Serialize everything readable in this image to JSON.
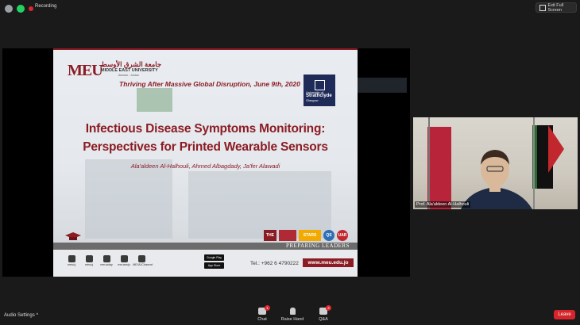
{
  "topbar": {
    "recording_label": "Recording",
    "exit_fullscreen_label": "Exit Full Screen",
    "colors": {
      "info_icon": "#9aa0a6",
      "shield_icon": "#23d160",
      "record_dot": "#e0262f"
    }
  },
  "slide": {
    "meu_logo": "MEU",
    "meu_arabic": "جامعة الشرق الأوسط",
    "meu_name": "MIDDLE EAST UNIVERSITY",
    "meu_location": "Amman - Jordan",
    "conference_title": "Thriving After Massive Global Disruption, June 9th, 2020",
    "partner_small": "University of",
    "partner_name": "Strathclyde",
    "partner_city": "Glasgow",
    "title_line1": "Infectious Disease Symptoms Monitoring:",
    "title_line2": "Perspectives for Printed Wearable Sensors",
    "authors": "Ala'aldeen Al-Halhouli, Ahmed Albagdady, Ja'fer Alawadi",
    "rankings": [
      "THE",
      "STARS",
      "QS",
      "UAR"
    ],
    "preparing_leaders": "PREPARING LEADERS",
    "social": [
      {
        "icon": "facebook-icon",
        "label": "meuuj"
      },
      {
        "icon": "instagram-icon",
        "label": "meuuj"
      },
      {
        "icon": "twitter-icon",
        "label": "meuoday"
      },
      {
        "icon": "snapchat-icon",
        "label": "meuamjo"
      },
      {
        "icon": "youtube-icon",
        "label": "MEUUChannel"
      }
    ],
    "google_play": "Google Play",
    "app_store": "App Store",
    "phone": "Tel.: +962 6 4790222",
    "website": "www.meu.edu.jo",
    "brand_color": "#8b1c24"
  },
  "video": {
    "participant_name": "Prof. Ala'aldeen Al-Halhouli"
  },
  "bottombar": {
    "audio_settings": "Audio Settings",
    "tools": [
      {
        "icon": "chat-icon",
        "label": "Chat",
        "badge": "1"
      },
      {
        "icon": "raise-hand-icon",
        "label": "Raise Hand",
        "badge": ""
      },
      {
        "icon": "qa-icon",
        "label": "Q&A",
        "badge": "2"
      }
    ],
    "leave_label": "Leave",
    "leave_color": "#d6242b"
  }
}
